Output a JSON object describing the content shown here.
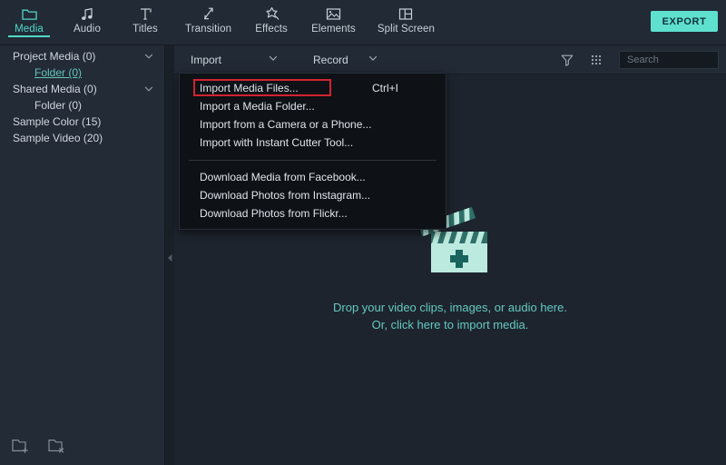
{
  "app": {
    "accent": "#4fd8c8",
    "highlight_box_color": "#d1242f",
    "sidebar_bg": "#232b36",
    "panel_bg": "#1e242e"
  },
  "topbar": {
    "tabs": [
      {
        "label": "Media",
        "icon": "folder-icon",
        "active": true
      },
      {
        "label": "Audio",
        "icon": "music-note-icon",
        "active": false
      },
      {
        "label": "Titles",
        "icon": "text-t-icon",
        "active": false
      },
      {
        "label": "Transition",
        "icon": "transition-arrow-icon",
        "active": false
      },
      {
        "label": "Effects",
        "icon": "sparkle-star-icon",
        "active": false
      },
      {
        "label": "Elements",
        "icon": "image-icon",
        "active": false
      },
      {
        "label": "Split Screen",
        "icon": "split-screen-icon",
        "active": false
      }
    ],
    "export_label": "EXPORT"
  },
  "sidebar": {
    "items": [
      {
        "label": "Project Media (0)",
        "level": 0,
        "chevron": true,
        "selected": false
      },
      {
        "label": "Folder (0)",
        "level": 1,
        "chevron": false,
        "selected": true
      },
      {
        "label": "Shared Media (0)",
        "level": 0,
        "chevron": true,
        "selected": false
      },
      {
        "label": "Folder (0)",
        "level": 1,
        "chevron": false,
        "selected": false
      },
      {
        "label": "Sample Color (15)",
        "level": 0,
        "chevron": false,
        "selected": false
      },
      {
        "label": "Sample Video (20)",
        "level": 0,
        "chevron": false,
        "selected": false
      }
    ],
    "actions": [
      {
        "name": "new-folder-icon"
      },
      {
        "name": "delete-folder-icon"
      }
    ],
    "collapse_icon": "collapse-left-arrow-icon"
  },
  "mediabar": {
    "import_label": "Import",
    "record_label": "Record",
    "filter_icon": "filter-icon",
    "grid_icon": "grid-view-icon",
    "search": {
      "placeholder": "Search",
      "value": "",
      "icon": "search-icon"
    }
  },
  "dropzone": {
    "icon": "clapperboard-plus-icon",
    "line1": "Drop your video clips, images, or audio here.",
    "line2": "Or, click here to import media."
  },
  "import_menu": {
    "items": [
      {
        "label": "Import Media Files...",
        "shortcut": "Ctrl+I",
        "highlighted": true
      },
      {
        "label": "Import a Media Folder...",
        "shortcut": "",
        "highlighted": false
      },
      {
        "label": "Import from a Camera or a Phone...",
        "shortcut": "",
        "highlighted": false
      },
      {
        "label": "Import with Instant Cutter Tool...",
        "shortcut": "",
        "highlighted": false
      },
      {
        "separator": true
      },
      {
        "label": "Download Media from Facebook...",
        "shortcut": "",
        "highlighted": false
      },
      {
        "label": "Download Photos from Instagram...",
        "shortcut": "",
        "highlighted": false
      },
      {
        "label": "Download Photos from Flickr...",
        "shortcut": "",
        "highlighted": false
      }
    ]
  }
}
